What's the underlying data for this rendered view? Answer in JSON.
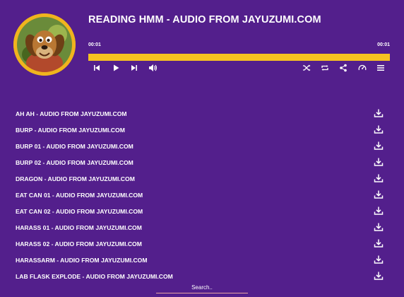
{
  "player": {
    "title": "READING HMM - AUDIO FROM JAYUZUMI.COM",
    "current_time": "00:01",
    "duration": "00:01",
    "progress_fraction": 1.0,
    "accent_color": "#f6c221",
    "background_color": "#531f8c",
    "controls_left": [
      "previous-icon",
      "play-icon",
      "next-icon",
      "volume-icon"
    ],
    "controls_right": [
      "shuffle-icon",
      "repeat-icon",
      "share-icon",
      "speed-icon",
      "playlist-icon"
    ]
  },
  "tracks": [
    {
      "name": "AH AH - AUDIO FROM JAYUZUMI.COM",
      "action_icon": "download-icon"
    },
    {
      "name": "BURP - AUDIO FROM JAYUZUMI.COM",
      "action_icon": "download-icon"
    },
    {
      "name": "BURP 01 - AUDIO FROM JAYUZUMI.COM",
      "action_icon": "download-icon"
    },
    {
      "name": "BURP 02 - AUDIO FROM JAYUZUMI.COM",
      "action_icon": "download-icon"
    },
    {
      "name": "DRAGON - AUDIO FROM JAYUZUMI.COM",
      "action_icon": "download-icon"
    },
    {
      "name": "EAT CAN 01 - AUDIO FROM JAYUZUMI.COM",
      "action_icon": "download-icon"
    },
    {
      "name": "EAT CAN 02 - AUDIO FROM JAYUZUMI.COM",
      "action_icon": "download-icon"
    },
    {
      "name": "HARASS 01 - AUDIO FROM JAYUZUMI.COM",
      "action_icon": "download-icon"
    },
    {
      "name": "HARASS 02 - AUDIO FROM JAYUZUMI.COM",
      "action_icon": "download-icon"
    },
    {
      "name": "HARASSARM - AUDIO FROM JAYUZUMI.COM",
      "action_icon": "download-icon"
    },
    {
      "name": "LAB FLASK EXPLODE - AUDIO FROM JAYUZUMI.COM",
      "action_icon": "download-icon"
    }
  ],
  "search": {
    "placeholder": "Search.."
  }
}
